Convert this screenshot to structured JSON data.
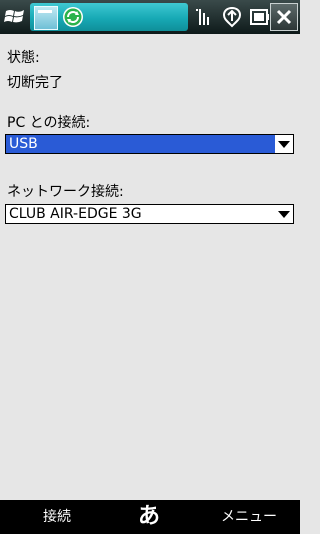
{
  "titlebar": {
    "icons": [
      "windows-start-icon",
      "connection-settings-icon",
      "sync-icon",
      "signal-strength-icon",
      "network-activity-icon",
      "battery-icon",
      "close-icon"
    ],
    "accent": "#17a9b5"
  },
  "status": {
    "label": "状態:",
    "value": "切断完了"
  },
  "pc_connection": {
    "label": "PC との接続:",
    "selected": "USB"
  },
  "network_connection": {
    "label": "ネットワーク接続:",
    "selected": "CLUB AIR-EDGE 3G"
  },
  "softkeys": {
    "left": "接続",
    "center": "あ",
    "right": "メニュー"
  },
  "colors": {
    "selection": "#2a5bd6",
    "background": "#e6e6e6"
  }
}
